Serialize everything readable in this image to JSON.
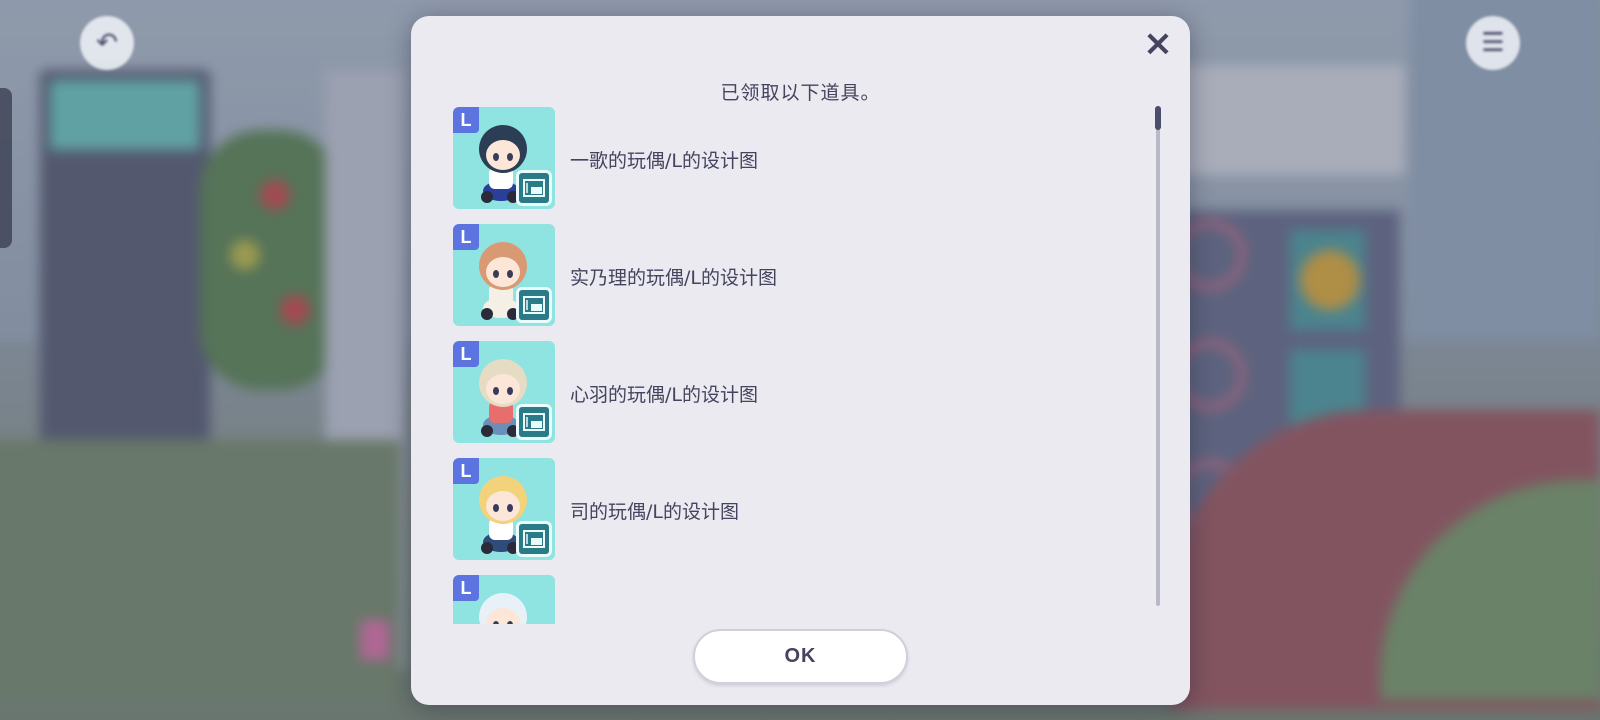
{
  "dialog": {
    "title": "已领取以下道具。",
    "close_icon": "×",
    "ok_label": "OK",
    "items": [
      {
        "name": "一歌的玩偶/L的设计图",
        "rank": "L",
        "hair": "#2c3e55",
        "shirt": "#ffffff",
        "pants": "#2a3f9a"
      },
      {
        "name": "实乃理的玩偶/L的设计图",
        "rank": "L",
        "hair": "#d99a73",
        "shirt": "#f4f0e6",
        "pants": "#f4f0e6"
      },
      {
        "name": "心羽的玩偶/L的设计图",
        "rank": "L",
        "hair": "#e6dcc4",
        "shirt": "#e86d6d",
        "pants": "#6b8fb8"
      },
      {
        "name": "司的玩偶/L的设计图",
        "rank": "L",
        "hair": "#f2d27a",
        "shirt": "#ffffff",
        "pants": "#2f4c7a"
      },
      {
        "name": "",
        "rank": "L",
        "hair": "#e9f1f8",
        "shirt": "#ffffff",
        "pants": "#ffffff"
      }
    ]
  },
  "colors": {
    "dialog_bg": "#ebeaf1",
    "thumb_bg": "#8fe3e0",
    "rank_badge": "#5b74e0",
    "text": "#44445f"
  }
}
